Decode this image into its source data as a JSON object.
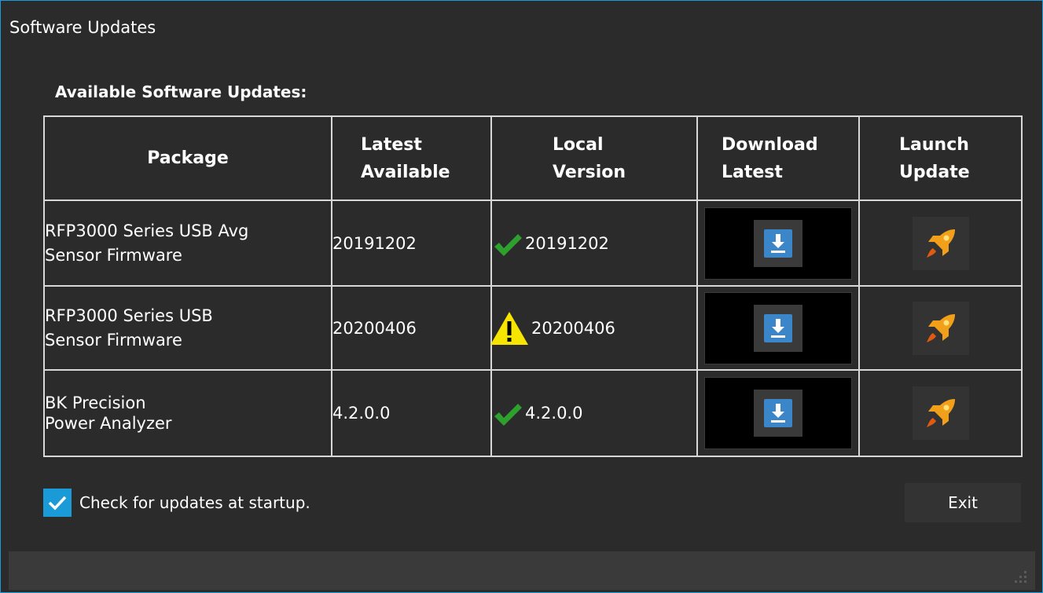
{
  "window": {
    "title": "Software Updates",
    "accent_color": "#1e9ad6"
  },
  "section": {
    "title": "Available Software Updates:"
  },
  "table": {
    "headers": {
      "package": "Package",
      "latest_line1": "Latest",
      "latest_line2": "Available",
      "local_line1": "Local",
      "local_line2": "Version",
      "download_line1": "Download",
      "download_line2": "Latest",
      "launch_line1": "Launch",
      "launch_line2": "Update"
    },
    "rows": [
      {
        "package_line1": "RFP3000 Series USB Avg",
        "package_line2": "Sensor Firmware",
        "latest": "20191202",
        "local": "20191202",
        "status_icon": "green-check-icon",
        "download_icon": "download-icon",
        "launch_icon": "rocket-icon"
      },
      {
        "package_line1": "RFP3000 Series USB",
        "package_line2": "Sensor Firmware",
        "latest": "20200406",
        "local": "20200406",
        "status_icon": "warning-icon",
        "download_icon": "download-icon",
        "launch_icon": "rocket-icon"
      },
      {
        "package_line1": "BK Precision",
        "package_line2": "Power Analyzer",
        "latest": "4.2.0.0",
        "local": "4.2.0.0",
        "status_icon": "green-check-icon",
        "download_icon": "download-icon",
        "launch_icon": "rocket-icon"
      }
    ]
  },
  "footer": {
    "check_label": "Check for updates at startup.",
    "check_checked": true,
    "exit_label": "Exit"
  },
  "colors": {
    "background": "#2b2b2b",
    "checkbox": "#1a9bd7",
    "check_green": "#2ea02e",
    "warning_yellow": "#f5e500",
    "rocket_orange": "#f2a01a",
    "download_blue": "#3a86c8"
  }
}
